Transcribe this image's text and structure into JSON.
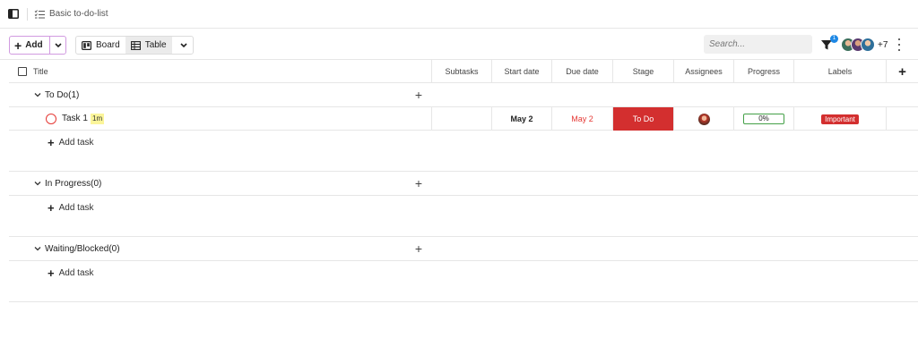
{
  "topbar": {
    "breadcrumb": "Basic to-do-list"
  },
  "toolbar": {
    "add_label": "Add",
    "views": [
      {
        "label": "Board"
      },
      {
        "label": "Table"
      }
    ],
    "active_view": "Table",
    "search_placeholder": "Search...",
    "filter_badge": "1",
    "more_members": "+7"
  },
  "table": {
    "columns": [
      "Title",
      "Subtasks",
      "Start date",
      "Due date",
      "Stage",
      "Assignees",
      "Progress",
      "Labels"
    ],
    "groups": [
      {
        "name": "To Do(1)",
        "tasks": [
          {
            "title": "Task 1",
            "duration": "1m",
            "subtasks": "",
            "start_date": "May 2",
            "due_date": "May 2",
            "stage": "To Do",
            "progress": "0%",
            "label": "Important"
          }
        ],
        "add_task_label": "Add task"
      },
      {
        "name": "In Progress(0)",
        "tasks": [],
        "add_task_label": "Add task"
      },
      {
        "name": "Waiting/Blocked(0)",
        "tasks": [],
        "add_task_label": "Add task"
      }
    ]
  },
  "colors": {
    "stage_todo": "#d32f2f",
    "label_important": "#d32f2f",
    "due_date_overdue": "#e53935",
    "progress_border": "#43a047",
    "add_button_border": "#d19ae0",
    "duration_highlight": "#fbf59a"
  }
}
